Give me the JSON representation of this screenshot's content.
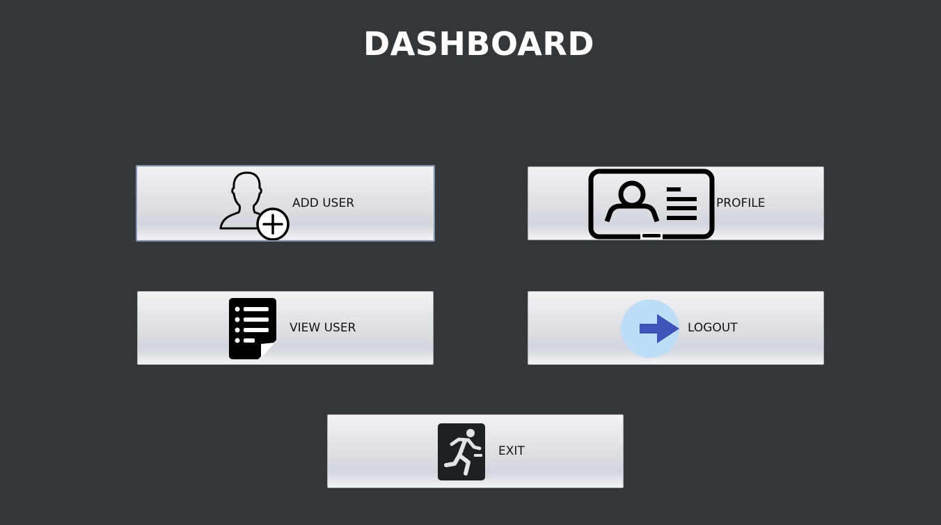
{
  "page": {
    "title": "DASHBOARD"
  },
  "buttons": {
    "add_user": {
      "label": "ADD USER",
      "icon": "add-user-icon"
    },
    "profile": {
      "label": "PROFILE",
      "icon": "id-card-icon"
    },
    "view_user": {
      "label": "VIEW USER",
      "icon": "document-list-icon"
    },
    "logout": {
      "label": "LOGOUT",
      "icon": "arrow-right-icon"
    },
    "exit": {
      "label": "EXIT",
      "icon": "running-exit-icon"
    }
  },
  "colors": {
    "background": "#343739",
    "title": "#ffffff",
    "logout_circle": "#bfdcf7",
    "logout_arrow": "#4152b8",
    "exit_icon_bg": "#1d2124"
  }
}
